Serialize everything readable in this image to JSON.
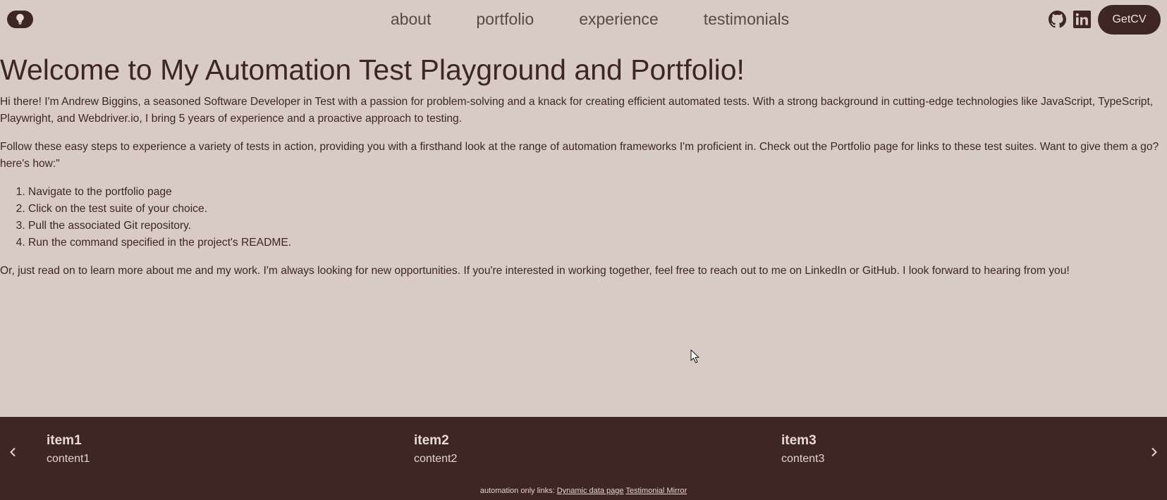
{
  "header": {
    "nav": [
      "about",
      "portfolio",
      "experience",
      "testimonials"
    ],
    "cv_label": "GetCV",
    "icons": {
      "theme": "lightbulb-icon",
      "github": "github-icon",
      "linkedin": "linkedin-icon"
    }
  },
  "main": {
    "title": "Welcome to My Automation Test Playground and Portfolio!",
    "intro": "Hi there! I'm Andrew Biggins, a seasoned Software Developer in Test with a passion for problem-solving and a knack for creating efficient automated tests. With a strong background in cutting-edge technologies like JavaScript, TypeScript, Playwright, and Webdriver.io, I bring 5 years of experience and a proactive approach to testing.",
    "follow": "Follow these easy steps to experience a variety of tests in action, providing you with a firsthand look at the range of automation frameworks I'm proficient in. Check out the Portfolio page for links to these test suites. Want to give them a go? here's how:\"",
    "steps": [
      "Navigate to the portfolio page",
      "Click on the test suite of your choice.",
      "Pull the associated Git repository.",
      "Run the command specified in the project's README."
    ],
    "outro": "Or, just read on to learn more about me and my work. I'm always looking for new opportunities. If you're interested in working together, feel free to reach out to me on LinkedIn or GitHub. I look forward to hearing from you!"
  },
  "carousel": {
    "items": [
      {
        "title": "item1",
        "content": "content1"
      },
      {
        "title": "item2",
        "content": "content2"
      },
      {
        "title": "item3",
        "content": "content3"
      }
    ],
    "prev_icon": "chevron-left-icon",
    "next_icon": "chevron-right-icon"
  },
  "footer": {
    "label": "automation only links:",
    "links": [
      "Dynamic data page",
      "Testimonial Mirror"
    ]
  },
  "colors": {
    "background": "#d8cbc6",
    "primary": "#3e2622",
    "nav_text": "#5a4844",
    "footer_text": "#e2d4cf"
  }
}
